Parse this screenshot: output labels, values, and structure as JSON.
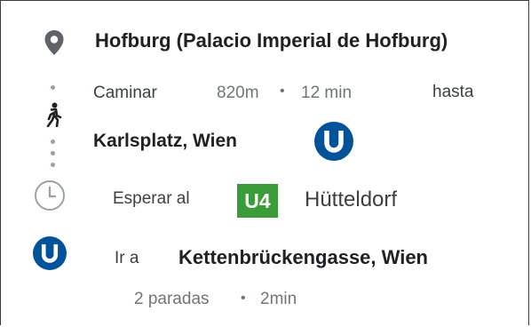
{
  "origin": {
    "name": "Hofburg (Palacio Imperial de Hofburg)"
  },
  "walk": {
    "mode_label": "Caminar",
    "distance": "820m",
    "separator": "•",
    "duration": "12 min",
    "until_label": "hasta",
    "destination": "Karlsplatz, Wien"
  },
  "wait": {
    "label": "Esperar al",
    "line": "U4",
    "line_color": "#3b9d3a",
    "direction": "Hütteldorf"
  },
  "ride": {
    "go_to_label": "Ir a",
    "destination": "Kettenbrückengasse, Wien",
    "stops": "2 paradas",
    "separator": "•",
    "duration": "2min"
  },
  "icons": {
    "origin": "location-pin-icon",
    "walk": "walking-person-icon",
    "transit": "ubahn-icon",
    "wait": "clock-icon"
  },
  "colors": {
    "ubahn": "#00529b",
    "line_u4": "#3b9d3a",
    "muted": "#70757a"
  }
}
